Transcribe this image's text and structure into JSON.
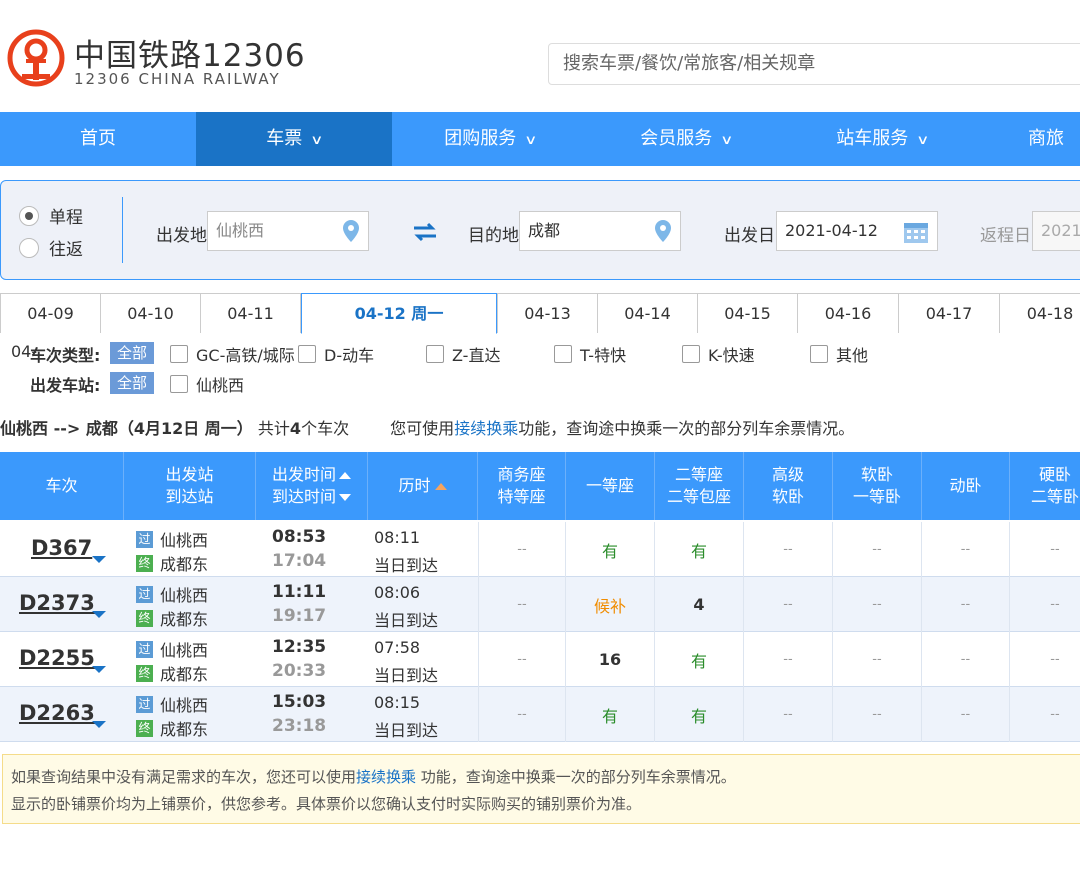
{
  "header": {
    "brand_cn": "中国铁路12306",
    "brand_en": "12306 CHINA RAILWAY",
    "search_placeholder": "搜索车票/餐饮/常旅客/相关规章",
    "brand_color": "#e8401c"
  },
  "nav": {
    "items": [
      {
        "label": "首页",
        "dropdown": false
      },
      {
        "label": "车票",
        "dropdown": true
      },
      {
        "label": "团购服务",
        "dropdown": true
      },
      {
        "label": "会员服务",
        "dropdown": true
      },
      {
        "label": "站车服务",
        "dropdown": true
      },
      {
        "label": "商旅",
        "dropdown": false
      }
    ],
    "color": "#3b99fc",
    "active_color": "#1a73c6"
  },
  "form": {
    "trip_one_way": "单程",
    "trip_round": "往返",
    "from_label": "出发地",
    "from_value": "仙桃西",
    "to_label": "目的地",
    "to_value": "成都",
    "date_label": "出发日",
    "date_value": "2021-04-12",
    "return_label": "返程日",
    "return_value": "2021-"
  },
  "date_tabs": [
    "04-09",
    "04-10",
    "04-11",
    "04-12 周一",
    "04-13",
    "04-14",
    "04-15",
    "04-16",
    "04-17",
    "04-18"
  ],
  "filters": {
    "overlap_text": "04-",
    "type_label": "车次类型:",
    "all": "全部",
    "types": [
      "GC-高铁/城际",
      "D-动车",
      "Z-直达",
      "T-特快",
      "K-快速",
      "其他"
    ],
    "station_label": "出发车站:",
    "stations": [
      "仙桃西"
    ]
  },
  "summary": {
    "route": "仙桃西 --> 成都（4月12日  周一）",
    "total_prefix": "共计",
    "total_count": "4",
    "total_suffix": "个车次",
    "tip_prefix": "您可使用",
    "tip_link": "接续换乘",
    "tip_suffix": "功能，查询途中换乘一次的部分列车余票情况。"
  },
  "table": {
    "headers": {
      "train": "车次",
      "station_1": "出发站",
      "station_2": "到达站",
      "time_1": "出发时间",
      "time_2": "到达时间",
      "duration": "历时",
      "business_1": "商务座",
      "business_2": "特等座",
      "first": "一等座",
      "second_1": "二等座",
      "second_2": "二等包座",
      "adv_soft_1": "高级",
      "adv_soft_2": "软卧",
      "soft_1": "软卧",
      "soft_2": "一等卧",
      "moving": "动卧",
      "hard_1": "硬卧",
      "hard_2": "二等卧"
    },
    "rows": [
      {
        "no": "D367",
        "from_badge": "过",
        "from": "仙桃西",
        "to_badge": "终",
        "to": "成都东",
        "dep": "08:53",
        "arr": "17:04",
        "dur": "08:11",
        "arrive_note": "当日到达",
        "business": "--",
        "first": "有",
        "second": "有",
        "adv_soft": "--",
        "soft": "--",
        "moving": "--",
        "hard": "--"
      },
      {
        "no": "D2373",
        "from_badge": "过",
        "from": "仙桃西",
        "to_badge": "终",
        "to": "成都东",
        "dep": "11:11",
        "arr": "19:17",
        "dur": "08:06",
        "arrive_note": "当日到达",
        "business": "--",
        "first": "候补",
        "second": "4",
        "adv_soft": "--",
        "soft": "--",
        "moving": "--",
        "hard": "--"
      },
      {
        "no": "D2255",
        "from_badge": "过",
        "from": "仙桃西",
        "to_badge": "终",
        "to": "成都东",
        "dep": "12:35",
        "arr": "20:33",
        "dur": "07:58",
        "arrive_note": "当日到达",
        "business": "--",
        "first": "16",
        "second": "有",
        "adv_soft": "--",
        "soft": "--",
        "moving": "--",
        "hard": "--"
      },
      {
        "no": "D2263",
        "from_badge": "过",
        "from": "仙桃西",
        "to_badge": "终",
        "to": "成都东",
        "dep": "15:03",
        "arr": "23:18",
        "dur": "08:15",
        "arrive_note": "当日到达",
        "business": "--",
        "first": "有",
        "second": "有",
        "adv_soft": "--",
        "soft": "--",
        "moving": "--",
        "hard": "--"
      }
    ]
  },
  "notice": {
    "line1_prefix": "如果查询结果中没有满足需求的车次，您还可以使用",
    "line1_link": "接续换乘",
    "line1_suffix": " 功能，查询途中换乘一次的部分列车余票情况。",
    "line2": "显示的卧铺票价均为上铺票价，供您参考。具体票价以您确认支付时实际购买的铺别票价为准。"
  }
}
